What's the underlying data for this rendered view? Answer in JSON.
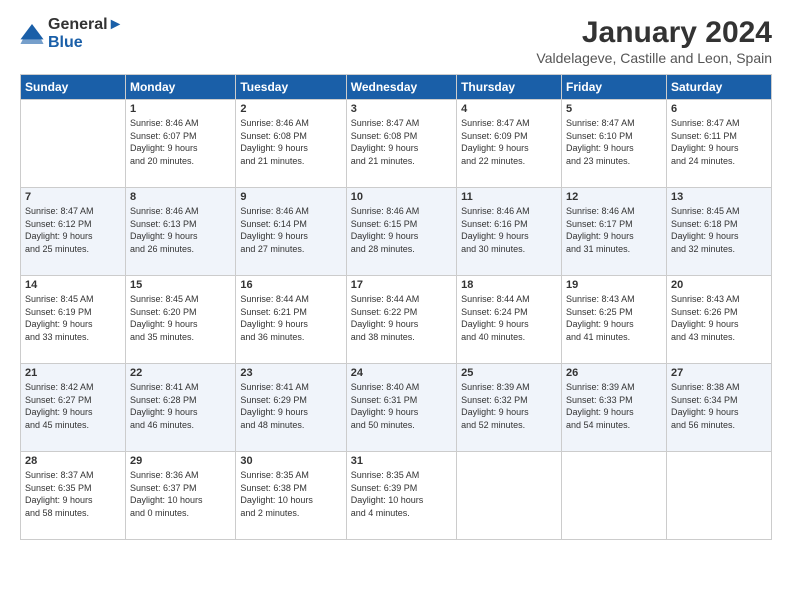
{
  "logo": {
    "line1": "General",
    "line2": "Blue"
  },
  "title": "January 2024",
  "subtitle": "Valdelageve, Castille and Leon, Spain",
  "days_header": [
    "Sunday",
    "Monday",
    "Tuesday",
    "Wednesday",
    "Thursday",
    "Friday",
    "Saturday"
  ],
  "weeks": [
    [
      {
        "day": "",
        "info": ""
      },
      {
        "day": "1",
        "info": "Sunrise: 8:46 AM\nSunset: 6:07 PM\nDaylight: 9 hours\nand 20 minutes."
      },
      {
        "day": "2",
        "info": "Sunrise: 8:46 AM\nSunset: 6:08 PM\nDaylight: 9 hours\nand 21 minutes."
      },
      {
        "day": "3",
        "info": "Sunrise: 8:47 AM\nSunset: 6:08 PM\nDaylight: 9 hours\nand 21 minutes."
      },
      {
        "day": "4",
        "info": "Sunrise: 8:47 AM\nSunset: 6:09 PM\nDaylight: 9 hours\nand 22 minutes."
      },
      {
        "day": "5",
        "info": "Sunrise: 8:47 AM\nSunset: 6:10 PM\nDaylight: 9 hours\nand 23 minutes."
      },
      {
        "day": "6",
        "info": "Sunrise: 8:47 AM\nSunset: 6:11 PM\nDaylight: 9 hours\nand 24 minutes."
      }
    ],
    [
      {
        "day": "7",
        "info": ""
      },
      {
        "day": "8",
        "info": "Sunrise: 8:46 AM\nSunset: 6:13 PM\nDaylight: 9 hours\nand 26 minutes."
      },
      {
        "day": "9",
        "info": "Sunrise: 8:46 AM\nSunset: 6:14 PM\nDaylight: 9 hours\nand 27 minutes."
      },
      {
        "day": "10",
        "info": "Sunrise: 8:46 AM\nSunset: 6:15 PM\nDaylight: 9 hours\nand 28 minutes."
      },
      {
        "day": "11",
        "info": "Sunrise: 8:46 AM\nSunset: 6:16 PM\nDaylight: 9 hours\nand 30 minutes."
      },
      {
        "day": "12",
        "info": "Sunrise: 8:46 AM\nSunset: 6:17 PM\nDaylight: 9 hours\nand 31 minutes."
      },
      {
        "day": "13",
        "info": "Sunrise: 8:45 AM\nSunset: 6:18 PM\nDaylight: 9 hours\nand 32 minutes."
      }
    ],
    [
      {
        "day": "14",
        "info": ""
      },
      {
        "day": "15",
        "info": "Sunrise: 8:45 AM\nSunset: 6:20 PM\nDaylight: 9 hours\nand 35 minutes."
      },
      {
        "day": "16",
        "info": "Sunrise: 8:44 AM\nSunset: 6:21 PM\nDaylight: 9 hours\nand 36 minutes."
      },
      {
        "day": "17",
        "info": "Sunrise: 8:44 AM\nSunset: 6:22 PM\nDaylight: 9 hours\nand 38 minutes."
      },
      {
        "day": "18",
        "info": "Sunrise: 8:44 AM\nSunset: 6:24 PM\nDaylight: 9 hours\nand 40 minutes."
      },
      {
        "day": "19",
        "info": "Sunrise: 8:43 AM\nSunset: 6:25 PM\nDaylight: 9 hours\nand 41 minutes."
      },
      {
        "day": "20",
        "info": "Sunrise: 8:43 AM\nSunset: 6:26 PM\nDaylight: 9 hours\nand 43 minutes."
      }
    ],
    [
      {
        "day": "21",
        "info": ""
      },
      {
        "day": "22",
        "info": "Sunrise: 8:41 AM\nSunset: 6:28 PM\nDaylight: 9 hours\nand 46 minutes."
      },
      {
        "day": "23",
        "info": "Sunrise: 8:41 AM\nSunset: 6:29 PM\nDaylight: 9 hours\nand 48 minutes."
      },
      {
        "day": "24",
        "info": "Sunrise: 8:40 AM\nSunset: 6:31 PM\nDaylight: 9 hours\nand 50 minutes."
      },
      {
        "day": "25",
        "info": "Sunrise: 8:39 AM\nSunset: 6:32 PM\nDaylight: 9 hours\nand 52 minutes."
      },
      {
        "day": "26",
        "info": "Sunrise: 8:39 AM\nSunset: 6:33 PM\nDaylight: 9 hours\nand 54 minutes."
      },
      {
        "day": "27",
        "info": "Sunrise: 8:38 AM\nSunset: 6:34 PM\nDaylight: 9 hours\nand 56 minutes."
      }
    ],
    [
      {
        "day": "28",
        "info": "Sunrise: 8:37 AM\nSunset: 6:35 PM\nDaylight: 9 hours\nand 58 minutes."
      },
      {
        "day": "29",
        "info": "Sunrise: 8:36 AM\nSunset: 6:37 PM\nDaylight: 10 hours\nand 0 minutes."
      },
      {
        "day": "30",
        "info": "Sunrise: 8:35 AM\nSunset: 6:38 PM\nDaylight: 10 hours\nand 2 minutes."
      },
      {
        "day": "31",
        "info": "Sunrise: 8:35 AM\nSunset: 6:39 PM\nDaylight: 10 hours\nand 4 minutes."
      },
      {
        "day": "",
        "info": ""
      },
      {
        "day": "",
        "info": ""
      },
      {
        "day": "",
        "info": ""
      }
    ]
  ],
  "week1_sun_info": "Sunrise: 8:47 AM\nSunset: 6:12 PM\nDaylight: 9 hours\nand 25 minutes.",
  "week3_sun_info": "Sunrise: 8:45 AM\nSunset: 6:19 PM\nDaylight: 9 hours\nand 33 minutes.",
  "week4_sun_info": "Sunrise: 8:42 AM\nSunset: 6:27 PM\nDaylight: 9 hours\nand 45 minutes.",
  "colors": {
    "header_bg": "#1a5fa8",
    "alt_row": "#eef2f9"
  }
}
